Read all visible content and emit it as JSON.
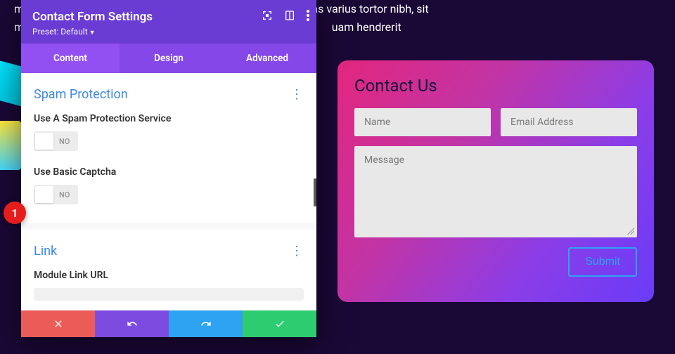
{
  "bg": {
    "line1": "m ipsum dolor sit amet, consectetur adipiscing elit. Maecenas varius tortor nibh, sit",
    "line2": "met",
    "line3": "uam hendrerit"
  },
  "panel": {
    "title": "Contact Form Settings",
    "preset_label": "Preset: Default",
    "tabs": {
      "content": "Content",
      "design": "Design",
      "advanced": "Advanced"
    },
    "sections": {
      "spam": {
        "title": "Spam Protection",
        "opt1": "Use A Spam Protection Service",
        "opt2": "Use Basic Captcha",
        "toggle_no": "NO"
      },
      "link": {
        "title": "Link",
        "opt1": "Module Link URL"
      }
    }
  },
  "marker": "1",
  "form": {
    "title": "Contact Us",
    "name_ph": "Name",
    "email_ph": "Email Address",
    "message_ph": "Message",
    "submit": "Submit"
  }
}
